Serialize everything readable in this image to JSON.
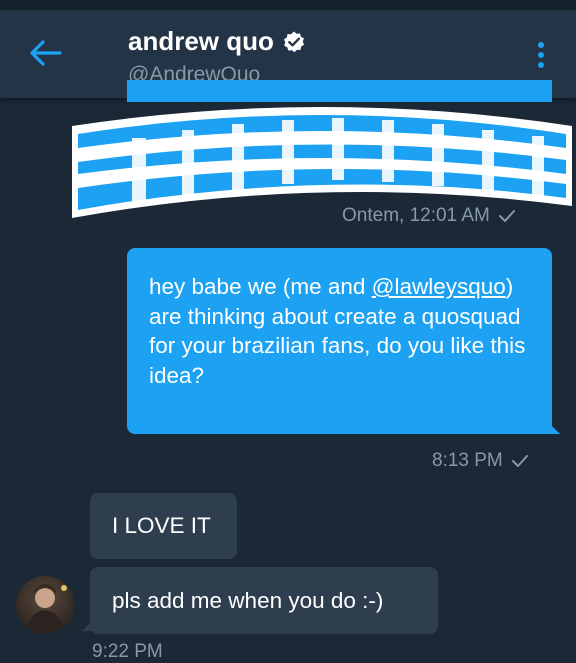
{
  "header": {
    "name": "andrew quo",
    "handle": "@AndrewQuo",
    "back_icon": "arrow-left-icon",
    "verified_icon": "verified-badge-icon",
    "more_icon": "more-vertical-icon"
  },
  "messages": {
    "sticker_time": "Ontem, 12:01 AM",
    "outgoing_text_part1": "hey babe we (me and ",
    "outgoing_mention": "@lawleysquo",
    "outgoing_text_part2": ") are thinking about create a quosquad for your brazilian fans, do you like this idea?",
    "outgoing_time": "8:13 PM",
    "incoming_1": "I LOVE IT",
    "incoming_2": "pls add me when you do :-)",
    "incoming_time_partial": "9:22 PM"
  },
  "colors": {
    "background": "#1b2836",
    "header": "#243447",
    "accent": "#1da1f2",
    "incoming_bubble": "#2f3e4f",
    "muted_text": "#8899a6"
  }
}
